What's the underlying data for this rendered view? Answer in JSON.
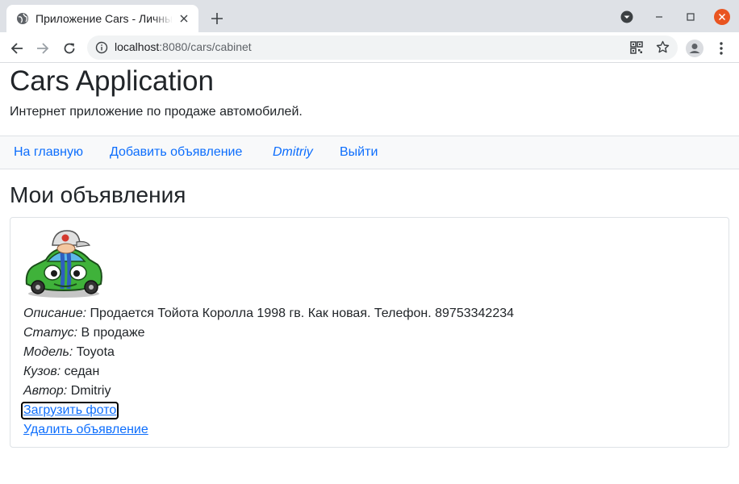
{
  "browser": {
    "tab_title": "Приложение Cars - Личный кабинет",
    "url_host": "localhost",
    "url_rest": ":8080/cars/cabinet"
  },
  "app": {
    "title": "Cars Application",
    "subtitle": "Интернет приложение по продаже автомобилей."
  },
  "nav": {
    "home": "На главную",
    "add": "Добавить объявление",
    "user": "Dmitriy",
    "logout": "Выйти"
  },
  "section_title": "Мои объявления",
  "listing": {
    "description_label": "Описание:",
    "description": "Продается Тойота Королла 1998 гв. Как новая. Телефон. 89753342234",
    "status_label": "Статус:",
    "status": "В продаже",
    "model_label": "Модель:",
    "model": "Toyota",
    "body_label": "Кузов:",
    "body": "седан",
    "author_label": "Автор:",
    "author": "Dmitriy",
    "upload_photo": "Загрузить фото",
    "delete": "Удалить объявление"
  },
  "colors": {
    "link": "#0d6efd",
    "navbar_bg": "#f8f9fa",
    "close_button": "#e95420"
  }
}
